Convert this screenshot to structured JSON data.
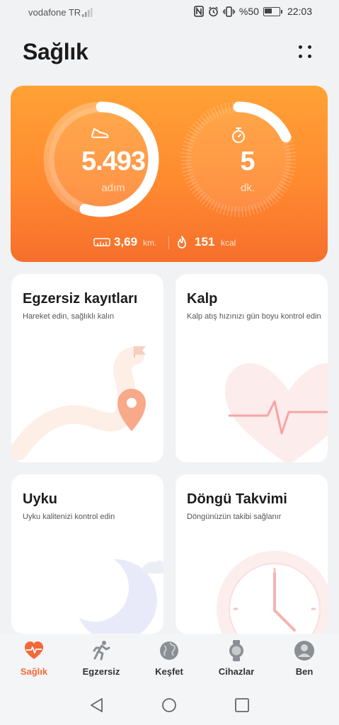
{
  "status_bar": {
    "carrier": "vodafone TR",
    "battery_text": "%50",
    "battery_level": 0.5,
    "time": "22:03",
    "icons": [
      "signal-icon",
      "nfc-icon",
      "alarm-icon",
      "vibrate-icon",
      "battery-icon"
    ]
  },
  "header": {
    "title": "Sağlık",
    "menu_icon": "dots-grid-icon"
  },
  "activity": {
    "steps": {
      "value": "5.493",
      "unit": "adım",
      "icon": "shoe-icon",
      "ring_progress": 0.55
    },
    "minutes": {
      "value": "5",
      "unit": "dk.",
      "icon": "stopwatch-icon",
      "ring_progress": 0.18
    },
    "distance": {
      "value": "3,69",
      "unit": "km.",
      "icon": "ruler-icon"
    },
    "calories": {
      "value": "151",
      "unit": "kcal",
      "icon": "flame-icon"
    },
    "colors": {
      "gradient_top": "#ffa235",
      "gradient_bottom": "#f66f2c",
      "ring": "#ffffff"
    }
  },
  "tiles": [
    {
      "title": "Egzersiz kayıtları",
      "subtitle": "Hareket edin, sağlıklı kalın",
      "art": "map-pin-route-icon"
    },
    {
      "title": "Kalp",
      "subtitle": "Kalp atış hızınızı gün boyu kontrol edin",
      "art": "heart-pulse-icon"
    },
    {
      "title": "Uyku",
      "subtitle": "Uyku kalitenizi kontrol edin",
      "art": "moon-icon"
    },
    {
      "title": "Döngü Takvimi",
      "subtitle": "Döngünüzün takibi sağlanır",
      "art": "clock-icon"
    }
  ],
  "bottom_nav": [
    {
      "label": "Sağlık",
      "icon": "heart-icon",
      "active": true
    },
    {
      "label": "Egzersiz",
      "icon": "runner-icon",
      "active": false
    },
    {
      "label": "Keşfet",
      "icon": "globe-icon",
      "active": false
    },
    {
      "label": "Cihazlar",
      "icon": "watch-icon",
      "active": false
    },
    {
      "label": "Ben",
      "icon": "profile-icon",
      "active": false
    }
  ],
  "system_nav": [
    "back-icon",
    "home-icon",
    "recents-icon"
  ],
  "accent_color": "#f3693a"
}
